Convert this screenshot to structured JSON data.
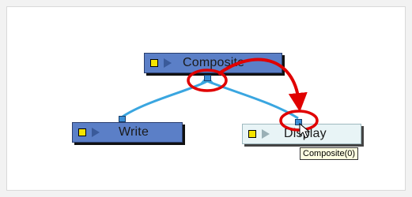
{
  "nodes": {
    "composite": {
      "label": "Composite"
    },
    "write": {
      "label": "Write"
    },
    "display": {
      "label": "Display"
    }
  },
  "tooltip": {
    "text": "Composite(0)"
  },
  "colors": {
    "node_fill": "#5b7fc7",
    "selected_node_fill": "#e8f4f6",
    "connection": "#3aa6e0",
    "highlight": "#e00000",
    "port": "#3b8fd6"
  }
}
